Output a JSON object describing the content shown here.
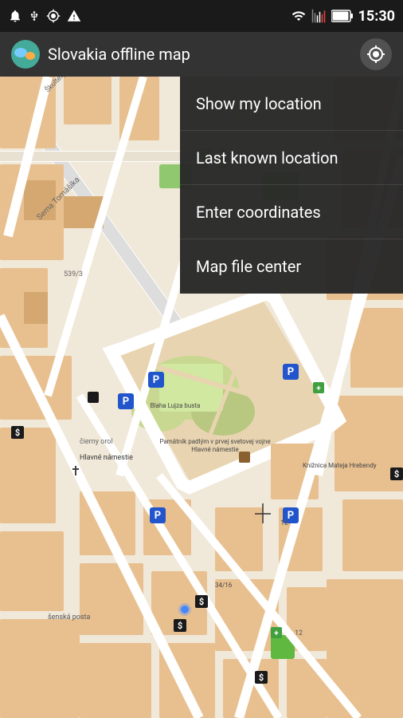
{
  "statusBar": {
    "time": "15:30",
    "icons": [
      "notification",
      "usb",
      "gps",
      "warning"
    ]
  },
  "appBar": {
    "title": "Slovakia offline map",
    "locationButtonLabel": "My location"
  },
  "menu": {
    "items": [
      {
        "id": "show-my-location",
        "label": "Show my location"
      },
      {
        "id": "last-known-location",
        "label": "Last known location"
      },
      {
        "id": "enter-coordinates",
        "label": "Enter coordinates"
      },
      {
        "id": "map-file-center",
        "label": "Map file center"
      }
    ]
  },
  "colors": {
    "statusBg": "#1a1a1a",
    "appBarBg": "#333333",
    "menuBg": "rgba(40,40,40,0.97)",
    "menuText": "#ffffff",
    "mapRoad": "#ffffff",
    "mapBlock": "#e8c99a",
    "mapGreen": "#c8d8a0",
    "mapPark": "#d4e8b0"
  }
}
